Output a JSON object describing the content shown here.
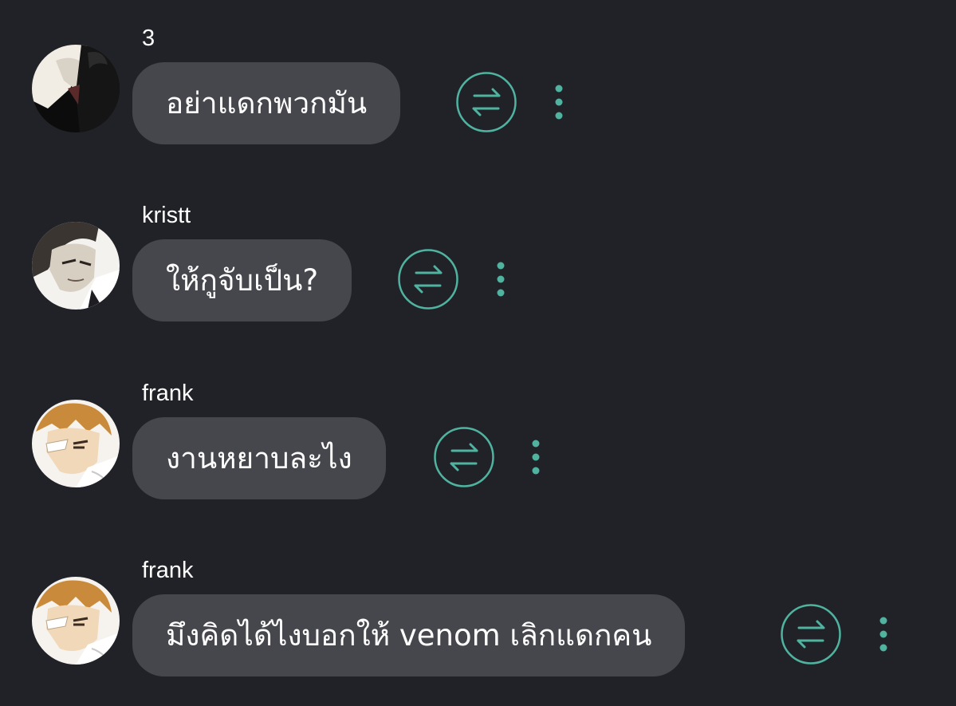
{
  "colors": {
    "background": "#212228",
    "bubble": "#46474d",
    "accent": "#4fb3a0",
    "text": "#ffffff"
  },
  "messages": [
    {
      "username": "3",
      "text": "อย่าแดกพวกมัน",
      "avatar_icon": "avatar-icon",
      "action_icon": "translate-icon",
      "menu_icon": "more-vertical-icon"
    },
    {
      "username": "kristt",
      "text": "ให้กูจับเป็น?",
      "avatar_icon": "avatar-icon",
      "action_icon": "translate-icon",
      "menu_icon": "more-vertical-icon"
    },
    {
      "username": "frank",
      "text": "งานหยาบละไง",
      "avatar_icon": "avatar-icon",
      "action_icon": "translate-icon",
      "menu_icon": "more-vertical-icon"
    },
    {
      "username": "frank",
      "text": "มึงคิดได้ไงบอกให้ venom เลิกแดกคน",
      "avatar_icon": "avatar-icon",
      "action_icon": "translate-icon",
      "menu_icon": "more-vertical-icon"
    }
  ]
}
